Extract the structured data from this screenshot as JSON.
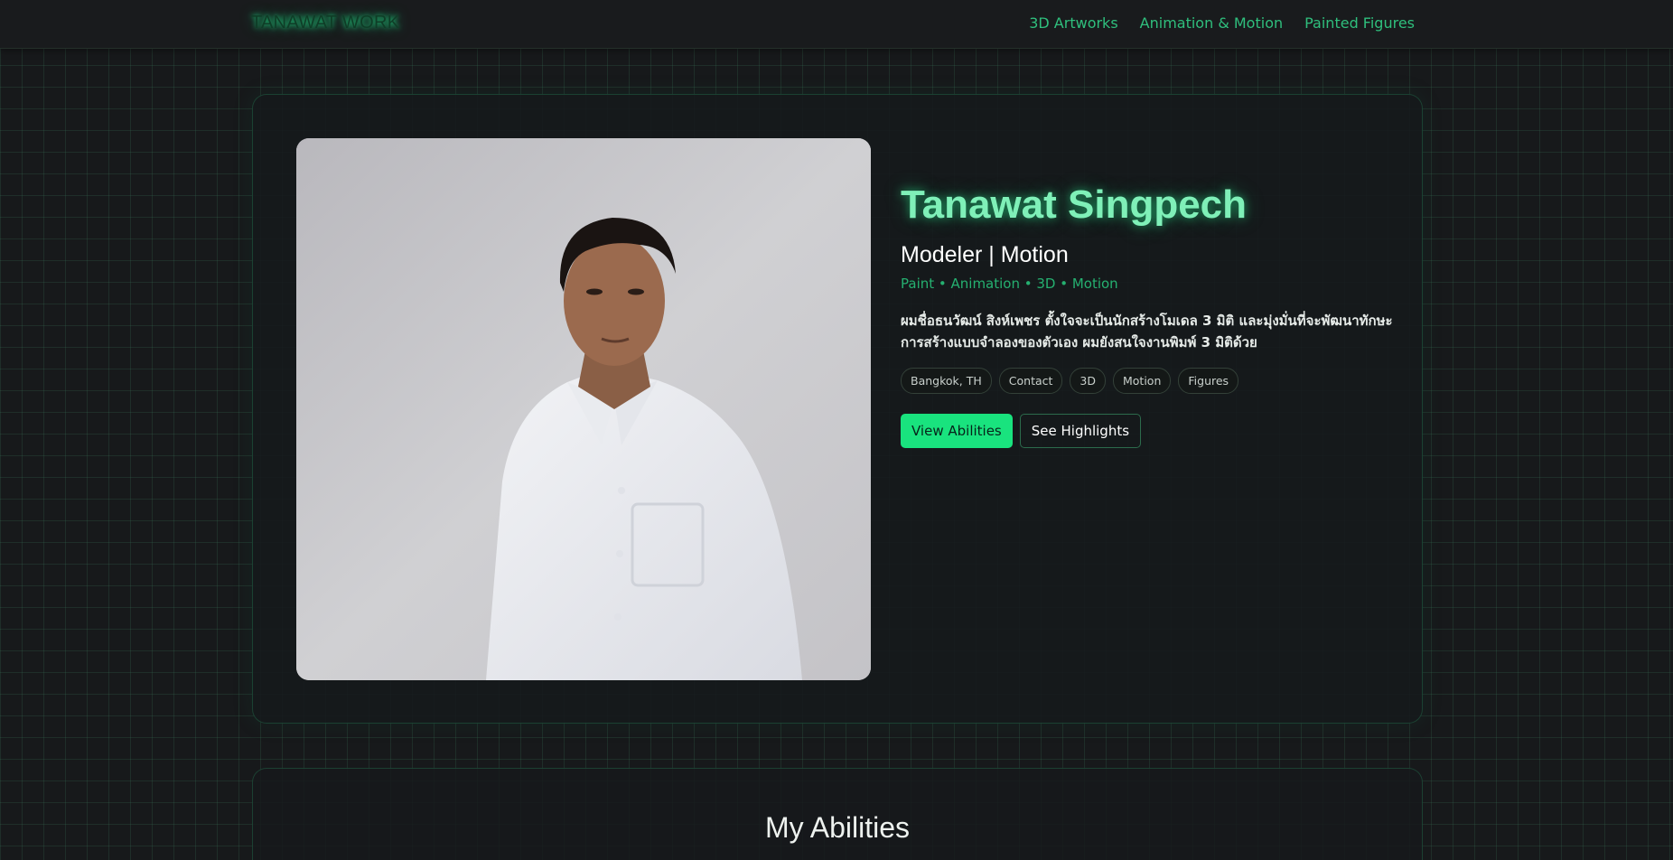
{
  "header": {
    "brand": "TANAWAT WORK",
    "nav": [
      "3D Artworks",
      "Animation & Motion",
      "Painted Figures"
    ]
  },
  "hero": {
    "name": "Tanawat Singpech",
    "role": "Modeler | Motion",
    "tagline": "Paint • Animation • 3D • Motion",
    "bio": "ผมชื่อธนวัฒน์ สิงห์เพชร ตั้งใจจะเป็นนักสร้างโมเดล 3 มิติ และมุ่งมั่นที่จะพัฒนาทักษะการสร้างแบบจำลองของตัวเอง ผมยังสนใจงานพิมพ์ 3 มิติด้วย",
    "chips": [
      "Bangkok, TH",
      "Contact",
      "3D",
      "Motion",
      "Figures"
    ],
    "primary_button": "View Abilities",
    "secondary_button": "See Highlights"
  },
  "abilities": {
    "title": "My Abilities"
  },
  "colors": {
    "accent": "#19e37e",
    "accent_text": "#2fbf7d",
    "name_glow": "#7ff0b8",
    "background": "#17191b"
  }
}
